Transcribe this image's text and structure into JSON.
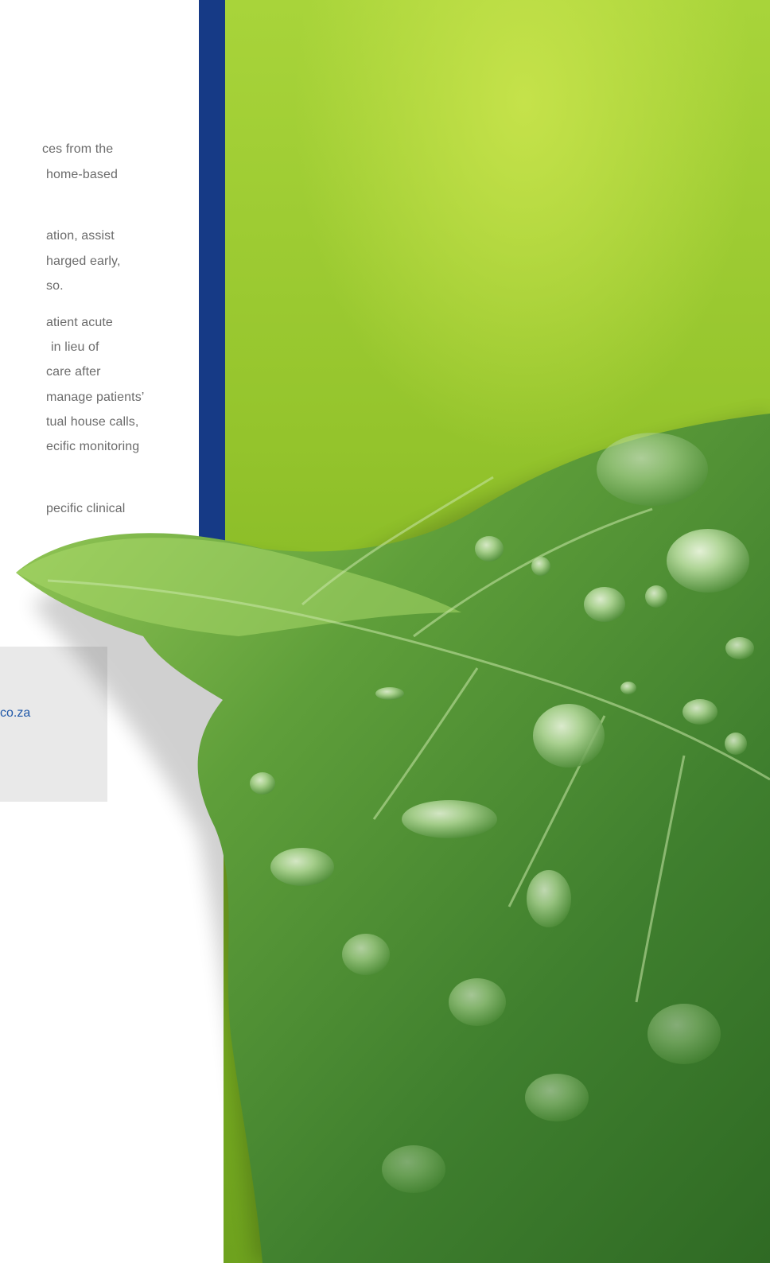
{
  "text_lines": [
    "ces from the",
    "home-based",
    "ation, assist",
    "harged early,",
    "so.",
    "atient acute",
    "in lieu of",
    "care after",
    "manage patients’",
    "tual house calls,",
    "ecific monitoring",
    "pecific clinical"
  ],
  "contact": {
    "link_text": "co.za"
  },
  "colors": {
    "band": "#163a86",
    "text": "#6b6b6b",
    "link": "#1f57a8",
    "box": "#e9e9e9",
    "photo_green": "#8cc22e"
  },
  "image": {
    "subject": "leaf-with-water-drops"
  }
}
